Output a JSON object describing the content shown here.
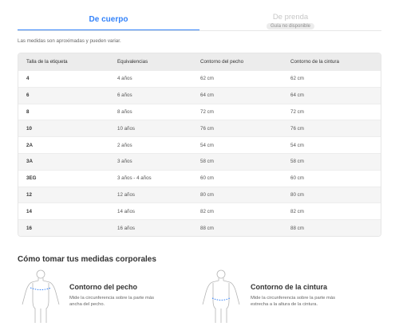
{
  "tabs": [
    {
      "label": "De cuerpo",
      "active": true
    },
    {
      "label": "De prenda",
      "badge": "Guía no disponible",
      "active": false
    }
  ],
  "disclaimer": "Las medidas son aproximadas y pueden variar.",
  "table": {
    "headers": [
      "Talla de la etiqueta",
      "Equivalencias",
      "Contorno del pecho",
      "Contorno de la cintura"
    ],
    "rows": [
      [
        "4",
        "4 años",
        "62 cm",
        "62 cm"
      ],
      [
        "6",
        "6 años",
        "64 cm",
        "64 cm"
      ],
      [
        "8",
        "8 años",
        "72 cm",
        "72 cm"
      ],
      [
        "10",
        "10 años",
        "76 cm",
        "76 cm"
      ],
      [
        "2A",
        "2 años",
        "54 cm",
        "54 cm"
      ],
      [
        "3A",
        "3 años",
        "58 cm",
        "58 cm"
      ],
      [
        "3EG",
        "3 años - 4 años",
        "60 cm",
        "60 cm"
      ],
      [
        "12",
        "12 años",
        "80 cm",
        "80 cm"
      ],
      [
        "14",
        "14 años",
        "82 cm",
        "82 cm"
      ],
      [
        "16",
        "16 años",
        "88 cm",
        "88 cm"
      ]
    ]
  },
  "how_to": {
    "title": "Cómo tomar tus medidas corporales",
    "items": [
      {
        "title": "Contorno del pecho",
        "description": "Mide la circunferencia sobre la parte más ancha del pecho.",
        "icon": "chest-measure-icon"
      },
      {
        "title": "Contorno de la cintura",
        "description": "Mide la circunferencia sobre la parte más estrecha a la altura de la cintura.",
        "icon": "waist-measure-icon"
      }
    ]
  },
  "colors": {
    "accent": "#3483fa",
    "header_bg": "#ececec",
    "row_alt": "#f5f5f5"
  }
}
